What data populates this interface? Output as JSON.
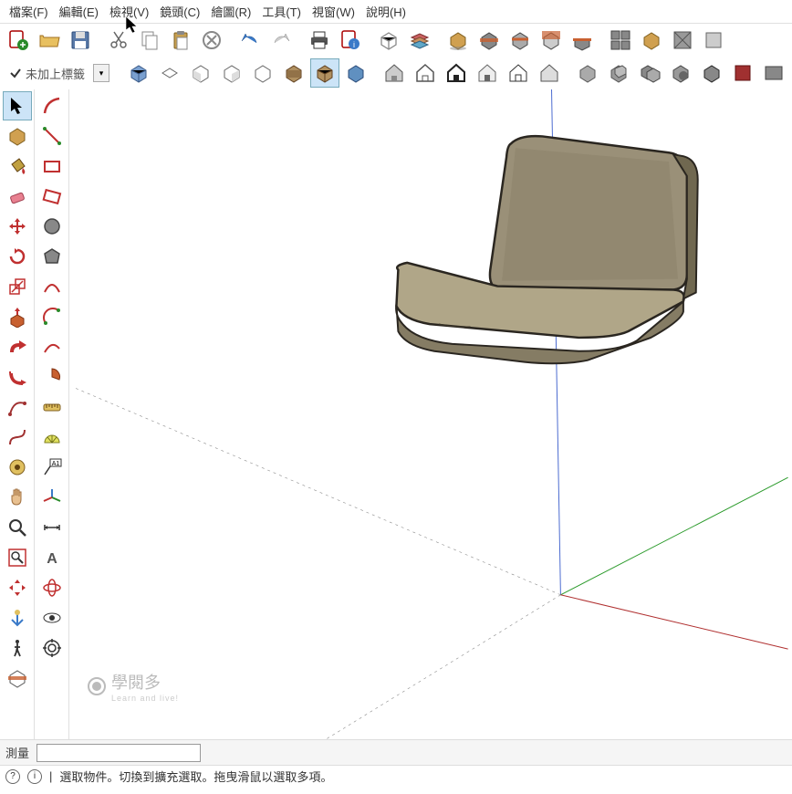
{
  "menu": {
    "file": "檔案(F)",
    "edit": "編輯(E)",
    "view": "檢視(V)",
    "camera": "鏡頭(C)",
    "draw": "繪圖(R)",
    "tools": "工具(T)",
    "window": "視窗(W)",
    "help": "說明(H)"
  },
  "tag_dropdown": {
    "text": "未加上標籤"
  },
  "bottom": {
    "label": "測量",
    "value": ""
  },
  "status": {
    "text": "選取物件。切換到擴充選取。拖曳滑鼠以選取多項。"
  },
  "watermark": {
    "text": "學閱多",
    "sub": "Learn and live!"
  },
  "icons": {
    "toolbar1": [
      "new-file",
      "open-file",
      "save-file",
      "cut",
      "copy",
      "paste",
      "delete",
      "undo",
      "redo",
      "print",
      "model-info",
      "extensions-1",
      "layers",
      "shadows",
      "section-1",
      "section-2",
      "section-3",
      "section-4",
      "section-5",
      "component-1",
      "component-2",
      "component-3",
      "component-4"
    ],
    "toolbar2": [
      "view-iso",
      "view-top",
      "view-front",
      "view-right",
      "view-back",
      "view-left",
      "style-1",
      "style-2",
      "style-3",
      "house-1",
      "house-2",
      "house-3",
      "house-4",
      "house-5",
      "house-6",
      "solid-1",
      "solid-2",
      "solid-3",
      "solid-4",
      "solid-5",
      "solid-6",
      "solid-7"
    ],
    "left1": [
      "select-tool",
      "make-component",
      "paint-bucket",
      "eraser",
      "move-tool",
      "rotate-tool",
      "scale-tool",
      "pushpull-tool",
      "followme-tool",
      "offset-tool",
      "tape-measure",
      "dimension-tool",
      "text-tool",
      "axes-tool",
      "azimuth",
      "walk-tool",
      "orbit-tool",
      "pan-tool",
      "zoom-tool",
      "zoom-extents",
      "position-camera",
      "lookaround-tool",
      "section-plane"
    ],
    "left2": [
      "line-tool",
      "freehand-tool",
      "rectangle-tool",
      "rotated-rect",
      "circle-tool",
      "polygon-tool",
      "arc-tool",
      "2pt-arc",
      "3pt-arc",
      "pie-tool",
      "unused-1",
      "unused-2",
      "unused-3",
      "protractor",
      "text-label",
      "3d-text",
      "axes-2",
      "unused-4",
      "unused-5"
    ]
  }
}
